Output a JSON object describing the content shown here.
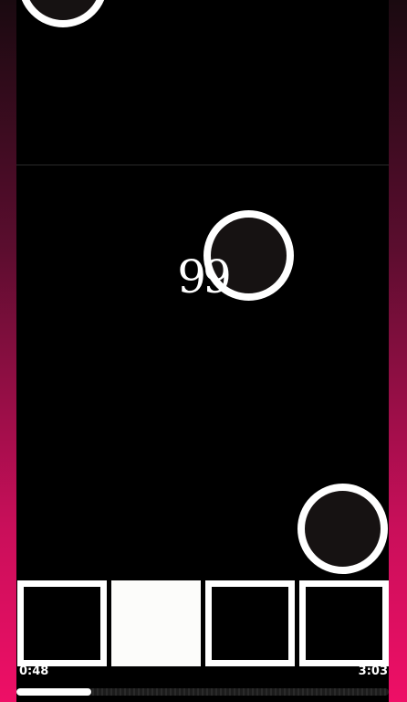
{
  "game": {
    "combo": "99",
    "lanes": [
      {
        "name": "lane-1",
        "active": false
      },
      {
        "name": "lane-2",
        "active": true
      },
      {
        "name": "lane-3",
        "active": false
      },
      {
        "name": "lane-4",
        "active": false
      }
    ],
    "notes": [
      {
        "lane": 1,
        "shape": "circle"
      },
      {
        "lane": 3,
        "shape": "circle"
      },
      {
        "lane": 4,
        "shape": "circle"
      }
    ]
  },
  "playback": {
    "elapsed": "0:48",
    "total": "3:03",
    "progress": 0.2
  },
  "colors": {
    "accent": "#ee0f66",
    "note_fill": "#161212",
    "note_stroke": "#ffffff",
    "active_key": "#fcfcfa"
  }
}
